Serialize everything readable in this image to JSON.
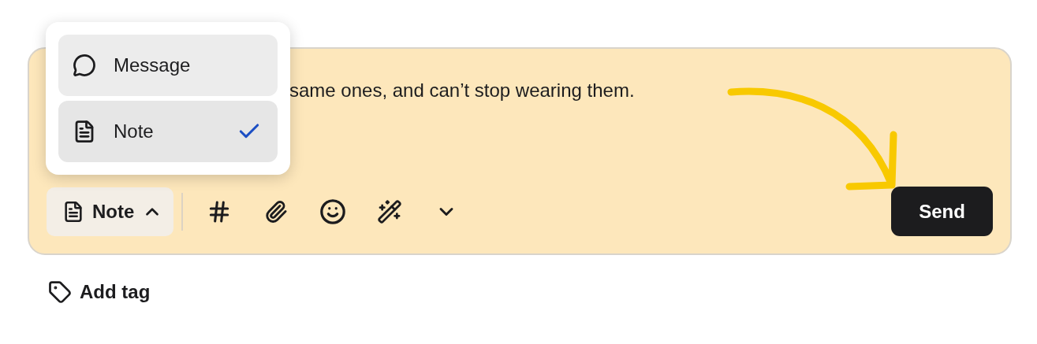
{
  "mode_menu": {
    "items": [
      {
        "label": "Message",
        "kind": "message",
        "selected": false
      },
      {
        "label": "Note",
        "kind": "note",
        "selected": true
      }
    ]
  },
  "composer": {
    "text": "same ones, and can’t stop wearing them.",
    "mode_button": {
      "label": "Note",
      "kind": "note",
      "expanded": true
    },
    "send_button": "Send"
  },
  "add_tag": "Add tag"
}
